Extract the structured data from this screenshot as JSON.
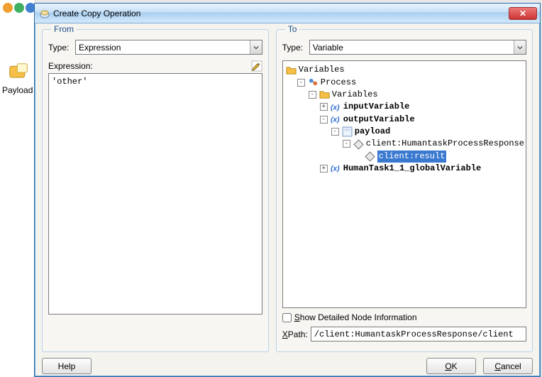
{
  "dialog": {
    "title": "Create Copy Operation"
  },
  "from": {
    "legend": "From",
    "type_label": "Type:",
    "type_value": "Expression",
    "expression_label": "Expression:",
    "expression_value": "'other'"
  },
  "to": {
    "legend": "To",
    "type_label": "Type:",
    "type_value": "Variable",
    "show_detail_label_prefix": "S",
    "show_detail_label_rest": "how Detailed Node Information",
    "xpath_label_prefix": "X",
    "xpath_label_rest": "Path:",
    "xpath_value": "/client:HumantaskProcessResponse/client",
    "tree": {
      "root": "Variables",
      "process": "Process",
      "vars": "Variables",
      "input": "inputVariable",
      "output": "outputVariable",
      "payload": "payload",
      "response": "client:HumantaskProcessResponse",
      "result": "client:result",
      "humantask": "HumanTask1_1_globalVariable"
    }
  },
  "buttons": {
    "help": "Help",
    "ok_u": "O",
    "ok_rest": "K",
    "cancel_u": "C",
    "cancel_rest": "ancel"
  },
  "bg": {
    "payload_label": "Payload"
  }
}
